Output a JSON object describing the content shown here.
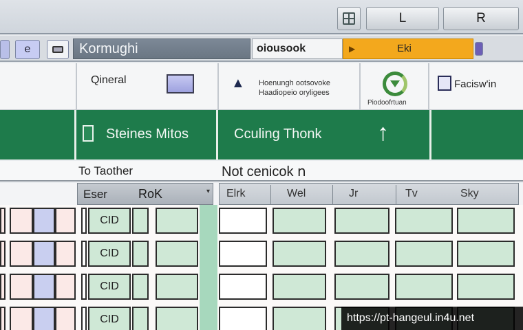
{
  "titlebar": {
    "btn_l": "L",
    "btn_r": "R"
  },
  "toolbar": {
    "e_label": "e",
    "document_title": "Kormughi",
    "search_value": "oiousook",
    "status_label": "Eki"
  },
  "ribbon": {
    "general_label": "Qineral",
    "warning_desc_line1": "Hoenungh ootsovoke",
    "warning_desc_line2": "Haadiopeio oryligees",
    "cycle_label": "Piodoofrtuan",
    "face_label": "Facisw'in"
  },
  "header_bar": {
    "stat1": "Steines Mitos",
    "stat2": "Cculing Thonk",
    "arrow": "↑"
  },
  "caption": {
    "left": "To Taother",
    "right": "Not cenicok ո"
  },
  "columns": {
    "left": [
      "Eser",
      "RoK"
    ],
    "right": [
      "Elrk",
      "Wel",
      "Jr",
      "Tv",
      "Sky"
    ]
  },
  "rows": [
    {
      "id": "CID"
    },
    {
      "id": "CID"
    },
    {
      "id": "CID"
    },
    {
      "id": "CID"
    }
  ],
  "watermark": "https://pt-hangeul.in4u.net"
}
